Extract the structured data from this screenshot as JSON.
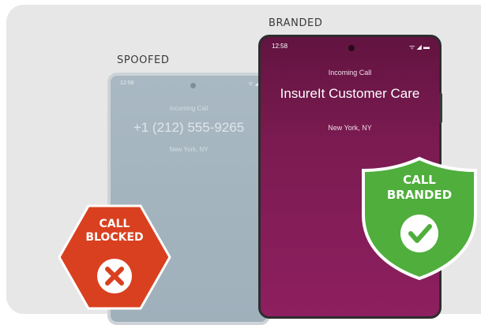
{
  "spoofed": {
    "caption": "SPOOFED",
    "time": "12:58",
    "status_icons": "ᯤ ◢",
    "incoming": "Incoming Call",
    "number": "+1 (212) 555-9265",
    "location": "New York, NY"
  },
  "branded": {
    "caption": "BRANDED",
    "time": "12:58",
    "status_icons": "ᯤ ◢ ▬",
    "incoming": "Incoming Call",
    "name": "InsureIt Customer Care",
    "location": "New York, NY"
  },
  "badges": {
    "blocked": {
      "line1": "CALL",
      "line2": "BLOCKED",
      "color": "#d9401f",
      "icon": "x-circle-icon"
    },
    "branded": {
      "line1": "CALL",
      "line2": "BRANDED",
      "color": "#4fae3c",
      "icon": "check-circle-icon"
    }
  }
}
